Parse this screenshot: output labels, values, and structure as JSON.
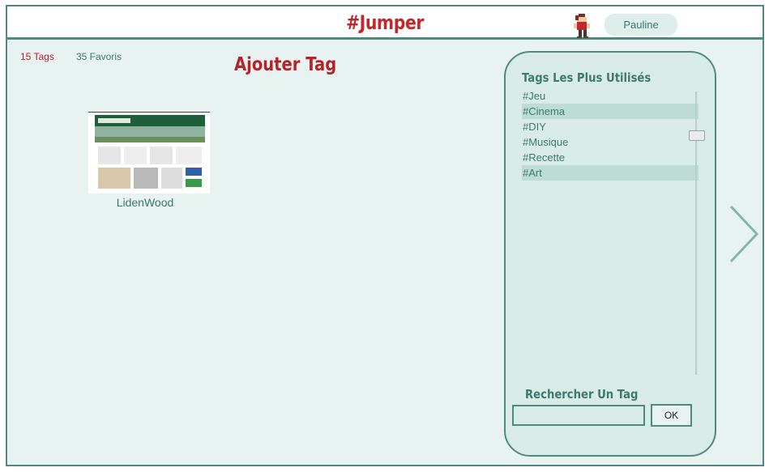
{
  "header": {
    "title": "#Jumper",
    "user_name": "Pauline"
  },
  "stats": {
    "tags_count": "15 Tags",
    "favorites_count": "35 Favoris"
  },
  "actions": {
    "add_tag_label": "Ajouter Tag"
  },
  "favorites": [
    {
      "label": "LidenWood"
    }
  ],
  "tags_panel": {
    "title": "Tags Les Plus Utilisés",
    "tags": [
      "#Jeu",
      "#Cinema",
      "#DIY",
      "#Musique",
      "#Recette",
      "#Art"
    ],
    "search_title": "Rechercher Un Tag",
    "search_value": "",
    "ok_label": "OK"
  },
  "colors": {
    "accent_red": "#c3262b",
    "accent_teal": "#4e8a80",
    "panel_bg": "#d9ebe7",
    "main_bg": "#e8f2f0"
  },
  "icons": {
    "next": "chevron-right-icon",
    "avatar": "pixel-character-avatar"
  }
}
